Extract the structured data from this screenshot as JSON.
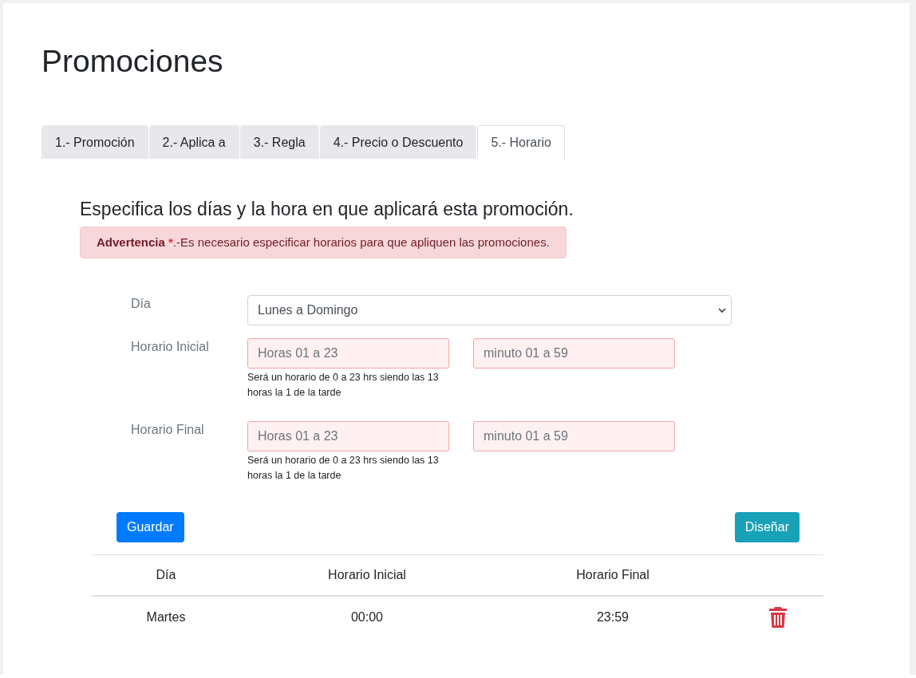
{
  "page_title": "Promociones",
  "tabs": [
    {
      "label": "1.- Promoción",
      "selected": false
    },
    {
      "label": "2.- Aplica a",
      "selected": false
    },
    {
      "label": "3.- Regla",
      "selected": false
    },
    {
      "label": "4.- Precio o Descuento",
      "selected": false
    },
    {
      "label": "5.- Horario",
      "selected": true
    }
  ],
  "section_title": "Especifica los días y la hora en que aplicará esta promoción.",
  "alert": {
    "lead": "Advertencia",
    "mark": "*",
    "text": ".-Es necesario especificar horarios para que apliquen las promociones."
  },
  "form": {
    "day": {
      "label": "Día",
      "value": "Lunes a Domingo"
    },
    "ranges": [
      {
        "label": "Horario Inicial",
        "hours_placeholder": "Horas 01 a 23",
        "minutes_placeholder": "minuto 01 a 59",
        "help": "Será un horario de 0 a 23 hrs siendo las 13 horas la 1 de la tarde",
        "invalid": true
      },
      {
        "label": "Horario Final",
        "hours_placeholder": "Horas 01 a 23",
        "minutes_placeholder": "minuto 01 a 59",
        "help": "Será un horario de 0 a 23 hrs siendo las 13 horas la 1 de la tarde",
        "invalid": true
      }
    ]
  },
  "buttons": {
    "save": "Guardar",
    "design": "Diseñar"
  },
  "table": {
    "columns": [
      "Día",
      "Horario Inicial",
      "Horario Final"
    ],
    "rows": [
      {
        "day": "Martes",
        "start": "00:00",
        "end": "23:59"
      }
    ]
  }
}
